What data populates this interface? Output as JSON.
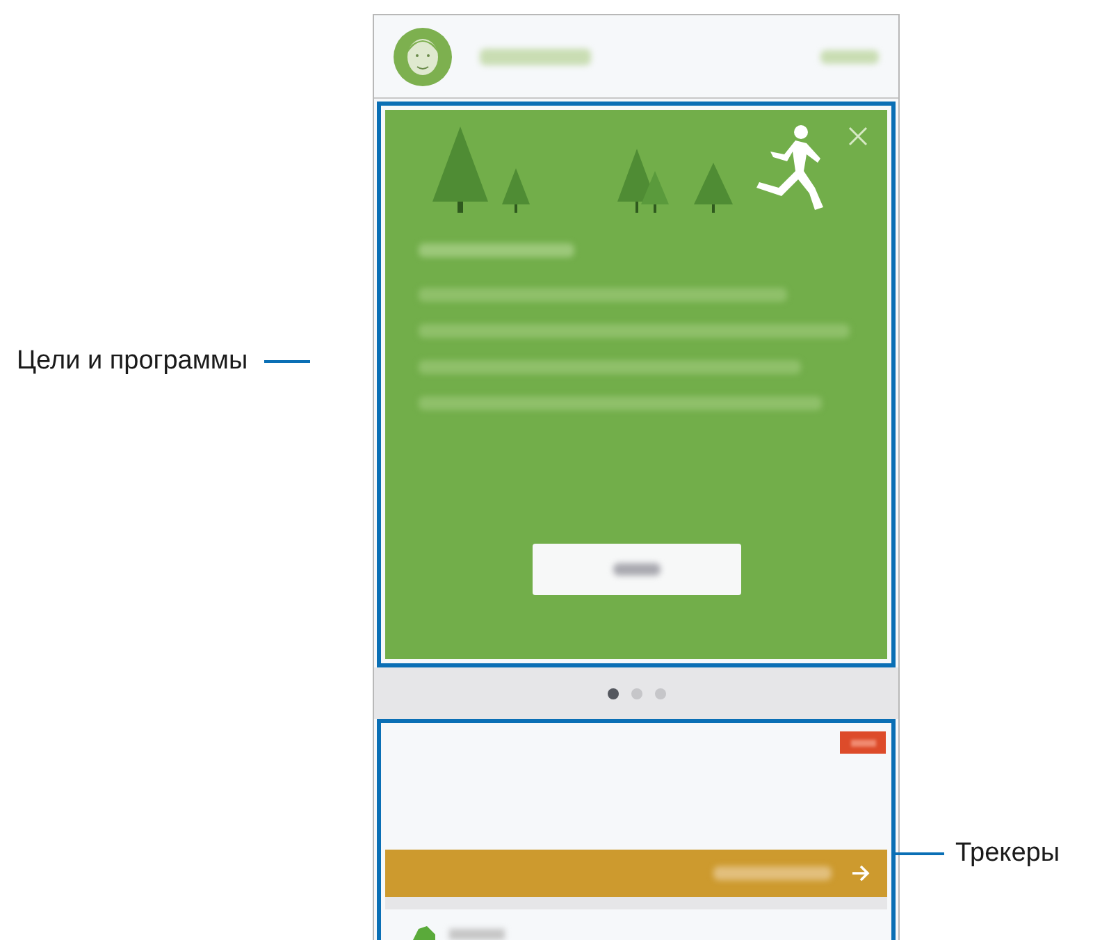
{
  "callouts": [
    {
      "label": "Цели и программы",
      "kind": "left"
    },
    {
      "label": "Трекеры",
      "kind": "right"
    }
  ],
  "pager": [
    {
      "selected": true
    },
    {
      "selected": false
    },
    {
      "selected": false
    }
  ]
}
